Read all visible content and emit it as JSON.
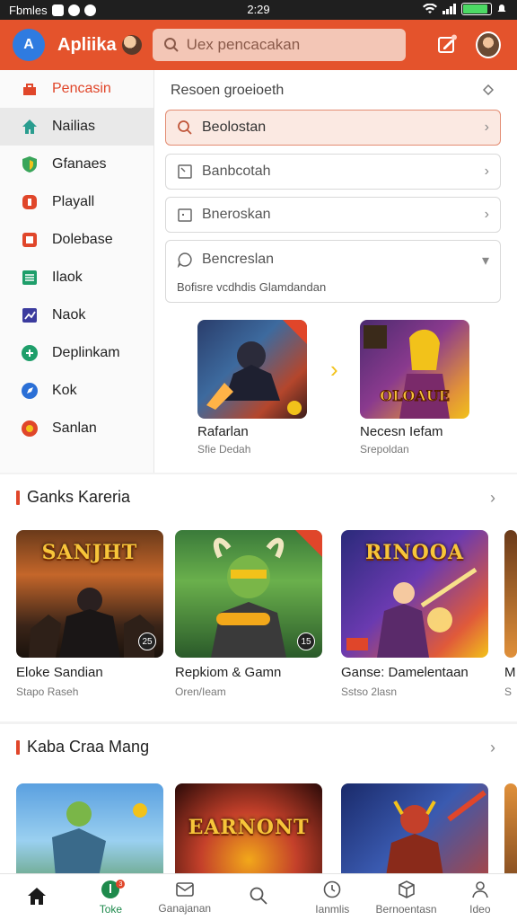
{
  "status_bar": {
    "carrier": "Fbmles",
    "time": "2:29",
    "battery_level": 0.9
  },
  "header": {
    "logo_text": "A",
    "app_name": "Apliika",
    "search_placeholder": "Uex pencacakan",
    "accent_color": "#e4532c"
  },
  "sidebar": {
    "items": [
      {
        "label": "Pencasin",
        "icon": "tag-icon",
        "color": "#e0462a"
      },
      {
        "label": "Nailias",
        "icon": "home-icon",
        "color": "#2a9d8f"
      },
      {
        "label": "Gfanaes",
        "icon": "shield-icon",
        "color": "#e9a21a"
      },
      {
        "label": "Playall",
        "icon": "bag-icon",
        "color": "#e0462a"
      },
      {
        "label": "Dolebase",
        "icon": "square-icon",
        "color": "#e0462a"
      },
      {
        "label": "Ilaok",
        "icon": "list-icon",
        "color": "#1e9e6a"
      },
      {
        "label": "Naok",
        "icon": "chart-icon",
        "color": "#3b3b9e"
      },
      {
        "label": "Deplinkam",
        "icon": "link-icon",
        "color": "#1e9e6a"
      },
      {
        "label": "Kok",
        "icon": "compass-icon",
        "color": "#2a6fd6"
      },
      {
        "label": "Sanlan",
        "icon": "pin-icon",
        "color": "#e0462a"
      }
    ]
  },
  "panel": {
    "title": "Resoen groeioeth",
    "fields": [
      {
        "label": "Beolostan"
      },
      {
        "label": "Banbcotah"
      },
      {
        "label": "Bneroskan"
      },
      {
        "label": "Bencreslan",
        "sub": "Bofisre vcdhdis Glamdandan"
      }
    ],
    "games": [
      {
        "title": "Rafarlan",
        "sub": "Sfie Dedah"
      },
      {
        "title": "Necesn Iefam",
        "sub": "Srepoldan"
      }
    ]
  },
  "section1": {
    "title": "Ganks Kareria",
    "tiles": [
      {
        "title": "Eloke Sandian",
        "sub": "Stapo Raseh",
        "art": "SANJHT",
        "num": "25"
      },
      {
        "title": "Repkiom & Gamn",
        "sub": "Oren/Ieam",
        "art": "",
        "num": "15"
      },
      {
        "title": "Ganse: Damelentaan",
        "sub": "Sstso 2lasn",
        "art": "RINOOA",
        "num": ""
      }
    ],
    "partial_title": "M",
    "partial_sub": "S"
  },
  "section2": {
    "title": "Kaba Craa Mang",
    "tiles": [
      {
        "art": ""
      },
      {
        "art": "EARNONT"
      },
      {
        "art": ""
      }
    ]
  },
  "bottom_nav": {
    "items": [
      {
        "label": "",
        "icon": "home-icon"
      },
      {
        "label": "Toke",
        "icon": "trophy-icon",
        "badge": "3"
      },
      {
        "label": "Ganajanan",
        "icon": "mail-icon"
      },
      {
        "label": "",
        "icon": "search-icon"
      },
      {
        "label": "Ianmlis",
        "icon": "clock-icon"
      },
      {
        "label": "Bernoentasn",
        "icon": "box-icon"
      },
      {
        "label": "Ideo",
        "icon": "user-icon"
      }
    ]
  }
}
